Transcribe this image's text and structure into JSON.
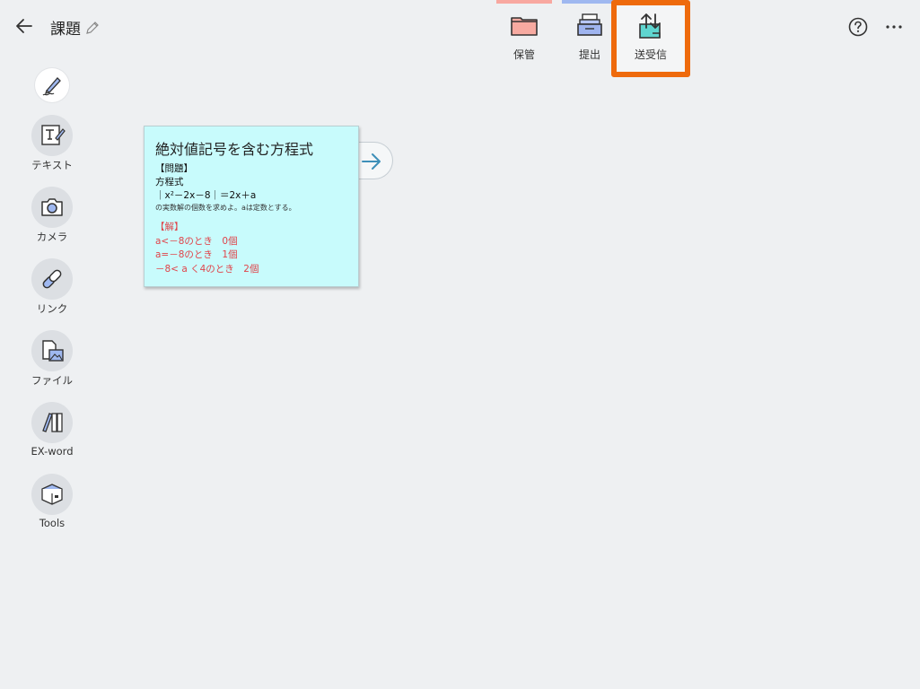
{
  "header": {
    "title": "課題"
  },
  "actions": {
    "keep_label": "保管",
    "submit_label": "提出",
    "send_receive_label": "送受信"
  },
  "sidebar": {
    "items": [
      {
        "label": ""
      },
      {
        "label": "テキスト"
      },
      {
        "label": "カメラ"
      },
      {
        "label": "リンク"
      },
      {
        "label": "ファイル"
      },
      {
        "label": "EX-word"
      },
      {
        "label": "Tools"
      }
    ]
  },
  "card": {
    "title": "絶対値記号を含む方程式",
    "problem_heading": "【問題】",
    "line1": "方程式",
    "equation": "｜x²－2x－8｜＝2x＋a",
    "instruction": "の実数解の個数を求めよ。aは定数とする。",
    "answer_heading": "【解】",
    "answer_lines": [
      "a<－8のとき　0個",
      "a=－8のとき　1個",
      "－8< a く4のとき　2個"
    ]
  },
  "colors": {
    "highlight_border": "#ee6a0c",
    "card_background": "#c8fbfc",
    "answer_text": "#e0444a",
    "keep_accent": "#f8a8a0",
    "submit_accent": "#9fb8f0"
  }
}
